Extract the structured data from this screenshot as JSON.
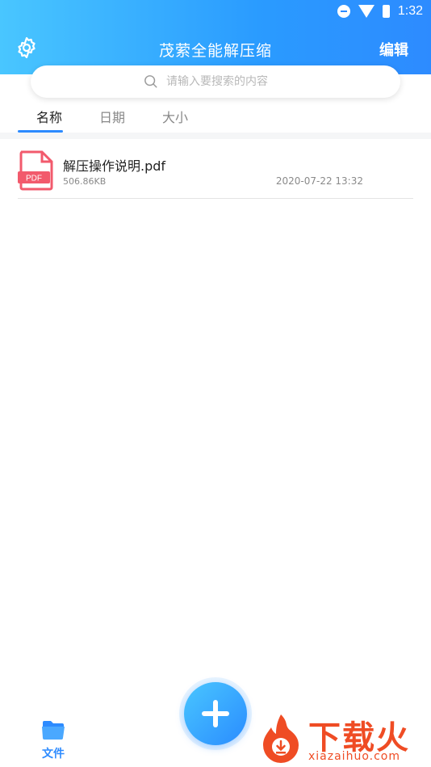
{
  "status_bar": {
    "time": "1:32"
  },
  "header": {
    "title": "茂萦全能解压缩",
    "edit_label": "编辑"
  },
  "search": {
    "placeholder": "请输入要搜索的内容"
  },
  "tabs": [
    {
      "label": "名称",
      "active": true
    },
    {
      "label": "日期",
      "active": false
    },
    {
      "label": "大小",
      "active": false
    }
  ],
  "files": [
    {
      "name": "解压操作说明.pdf",
      "size": "506.86KB",
      "date": "2020-07-22 13:32",
      "icon": "pdf-file-icon",
      "icon_label": "PDF"
    }
  ],
  "bottom_nav": {
    "files_label": "文件"
  },
  "watermark": {
    "text": "下载火",
    "sub": "xiazaihuo.com"
  },
  "colors": {
    "accent": "#2d8bff",
    "pdf_red": "#f25a6c",
    "watermark": "#ef4c24"
  }
}
